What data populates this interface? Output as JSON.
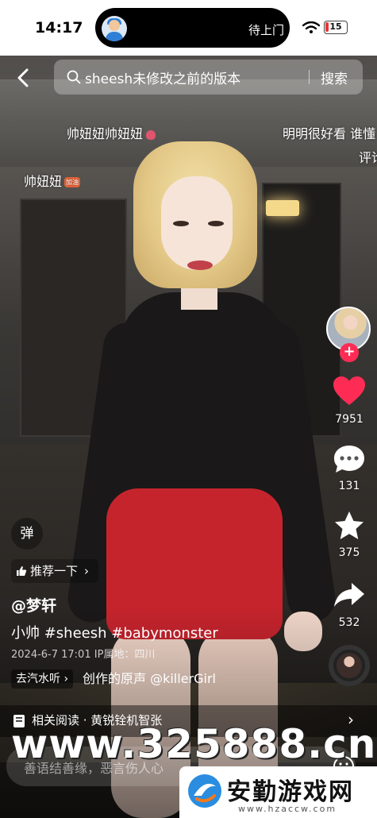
{
  "status_bar": {
    "time": "14:17",
    "island_text": "待上门",
    "battery_level": "15",
    "battery_fraction": 0.15
  },
  "search": {
    "query": "sheesh未修改之前的版本",
    "button_label": "搜索"
  },
  "danmaku": [
    {
      "text": "帅妞妞帅妞妞"
    },
    {
      "text": "明明很好看 谁懂"
    },
    {
      "text": "评论"
    },
    {
      "text": "帅妞妞"
    }
  ],
  "danmaku_level_badge": "加油",
  "rail": {
    "likes": "7951",
    "comments": "131",
    "favorites": "375",
    "shares": "532"
  },
  "info": {
    "danmu_toggle": "弹",
    "recommend_label": "推荐一下",
    "author": "@梦轩",
    "caption": "小帅 #sheesh #babymonster",
    "meta": "2024-6-7 17:01 IP属地：四川",
    "music_tag": "去汽水听",
    "music_text": "创作的原声  @killerGirl"
  },
  "related": {
    "text": "相关阅读 · 黄锐铨机智张"
  },
  "comment": {
    "placeholder": "善语结善缘，恶言伤人心"
  },
  "watermark": {
    "url": "www.325888.cn",
    "logo_title": "安勤游戏网",
    "logo_sub": "www.hzaccw.com"
  },
  "colors": {
    "accent_red": "#fe2c55",
    "like_red": "#fe2c55",
    "logo_blue": "#2a8de0",
    "logo_orange": "#f07a1d"
  }
}
